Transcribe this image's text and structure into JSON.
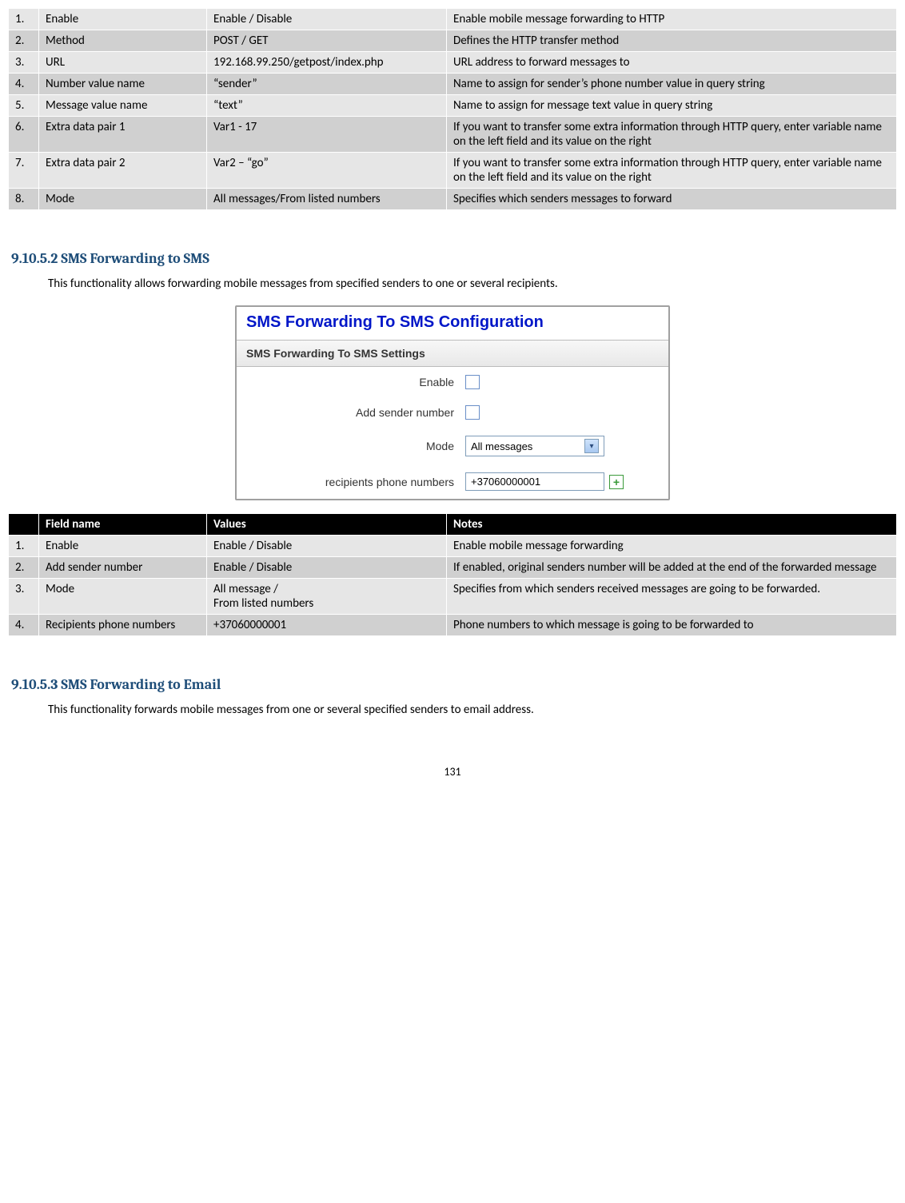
{
  "table1": {
    "rows": [
      {
        "n": "1.",
        "field": "Enable",
        "val": "Enable / Disable",
        "notes": "Enable mobile message forwarding to HTTP"
      },
      {
        "n": "2.",
        "field": "Method",
        "val": "POST / GET",
        "notes": "Defines the HTTP transfer method"
      },
      {
        "n": "3.",
        "field": "URL",
        "val": "192.168.99.250/getpost/index.php",
        "notes": "URL address to forward messages to"
      },
      {
        "n": "4.",
        "field": "Number value name",
        "val": "“sender”",
        "notes": "Name to assign for sender’s phone number value in query string"
      },
      {
        "n": "5.",
        "field": "Message value name",
        "val": "“text”",
        "notes": "Name to assign for message text value in query string"
      },
      {
        "n": "6.",
        "field": "Extra data pair 1",
        "val": "Var1 - 17",
        "notes": "If you want to transfer some extra information through HTTP query, enter variable name on the left field and its value on the right"
      },
      {
        "n": "7.",
        "field": "Extra data pair 2",
        "val": "Var2 – “go”",
        "notes": "If you want to transfer some extra information through HTTP query, enter variable name on the left field and its value on the right"
      },
      {
        "n": "8.",
        "field": "Mode",
        "val": "All messages/From listed numbers",
        "notes": "Specifies which senders messages to forward"
      }
    ]
  },
  "section2": {
    "number": "9.10.5.2",
    "title": "SMS Forwarding to SMS",
    "body": "This functionality allows forwarding mobile messages from specified senders to one or several recipients."
  },
  "panel": {
    "title": "SMS Forwarding To SMS Configuration",
    "subhead": "SMS Forwarding To SMS Settings",
    "labels": {
      "enable": "Enable",
      "add_sender": "Add sender number",
      "mode": "Mode",
      "recipients": "recipients phone numbers"
    },
    "mode_value": "All messages",
    "recipients_value": "+37060000001"
  },
  "table2": {
    "header": {
      "field": "Field name",
      "val": "Values",
      "notes": "Notes"
    },
    "rows": [
      {
        "n": "1.",
        "field": "Enable",
        "val": "Enable / Disable",
        "notes": "Enable mobile message forwarding"
      },
      {
        "n": "2.",
        "field": "Add sender number",
        "val": "Enable / Disable",
        "notes": "If enabled, original senders number will be added at the end of the forwarded message"
      },
      {
        "n": "3.",
        "field": "Mode",
        "val": "All message /\nFrom listed numbers",
        "notes": "Specifies from which senders received messages are going to be forwarded."
      },
      {
        "n": "4.",
        "field": "Recipients phone numbers",
        "val": "+37060000001",
        "notes": "Phone numbers to which message is going to be forwarded to"
      }
    ]
  },
  "section3": {
    "number": "9.10.5.3",
    "title": "SMS Forwarding to Email",
    "body": "This functionality forwards mobile messages from one or several specified senders to email address."
  },
  "page_number": "131"
}
